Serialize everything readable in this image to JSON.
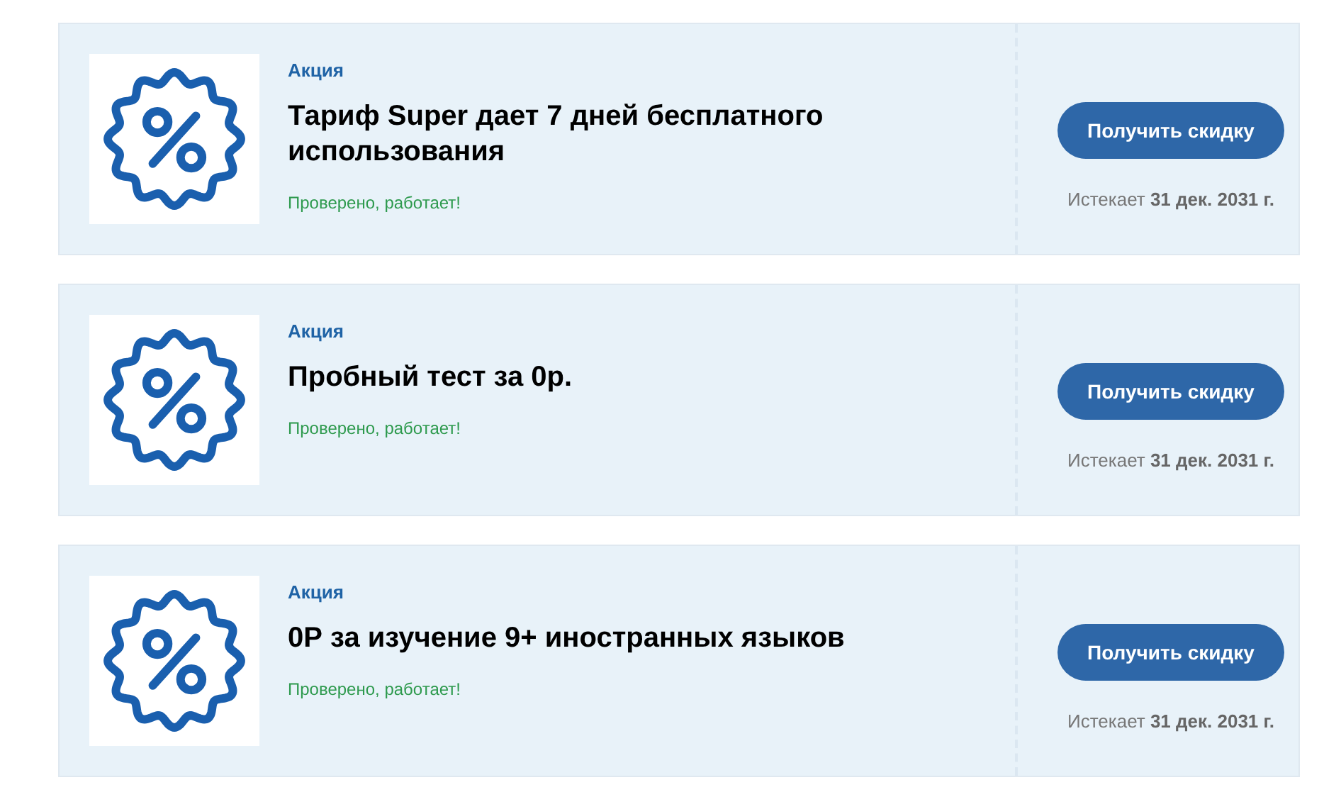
{
  "offers": [
    {
      "tag": "Акция",
      "title": "Тариф Super дает 7 дней бесплатного использования",
      "status": "Проверено, работает!",
      "button": "Получить скидку",
      "expiry": "Истекает **31 дек. 2031 г.**"
    },
    {
      "tag": "Акция",
      "title": "Пробный тест за 0р.",
      "status": "Проверено, работает!",
      "button": "Получить скидку",
      "expiry": "Истекает **31 дек. 2031 г.**"
    },
    {
      "tag": "Акция",
      "title": "0Р за изучение 9+ иностранных языков",
      "status": "Проверено, работает!",
      "button": "Получить скидку",
      "expiry": "Истекает **31 дек. 2031 г.**"
    }
  ]
}
